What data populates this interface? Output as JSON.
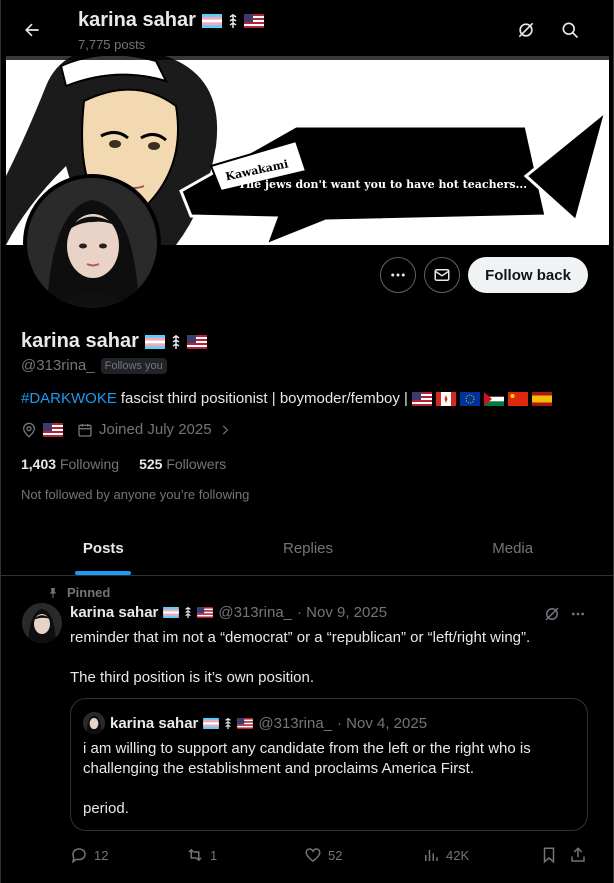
{
  "header": {
    "name": "karina sahar",
    "post_count": "7,775 posts"
  },
  "banner": {
    "speech_name": "Kawakami",
    "speech_text": "The jews don't want you to have hot teachers..."
  },
  "profile": {
    "name": "karina sahar",
    "handle": "@313rina_",
    "follows_you": "Follows you",
    "follow_button": "Follow back",
    "bio_hashtag": "#DARKWOKE",
    "bio_text": "fascist third positionist | boymoder/femboy |",
    "joined": "Joined July 2025",
    "following_count": "1,403",
    "following_label": "Following",
    "followers_count": "525",
    "followers_label": "Followers",
    "not_followed": "Not followed by anyone you’re following"
  },
  "tabs": [
    {
      "label": "Posts"
    },
    {
      "label": "Replies"
    },
    {
      "label": "Media"
    }
  ],
  "post": {
    "pinned_label": "Pinned",
    "name": "karina sahar",
    "handle": "@313rina_",
    "date": "· Nov 9, 2025",
    "text_line1": "reminder that im not a “democrat” or a “republican” or “left/right wing”.",
    "text_line2": "The third position is it’s own position.",
    "quote": {
      "name": "karina sahar",
      "handle": "@313rina_",
      "date": "· Nov 4, 2025",
      "text_para1": "i am willing to support any candidate from the left or the right who is challenging the establishment and proclaims America First.",
      "text_para2": "period."
    },
    "replies": "12",
    "reposts": "1",
    "likes": "52",
    "views": "42K"
  },
  "colors": {
    "accent": "#1d9bf0",
    "text": "#e7e9ea",
    "muted": "#71767b",
    "border": "#2f3336"
  }
}
